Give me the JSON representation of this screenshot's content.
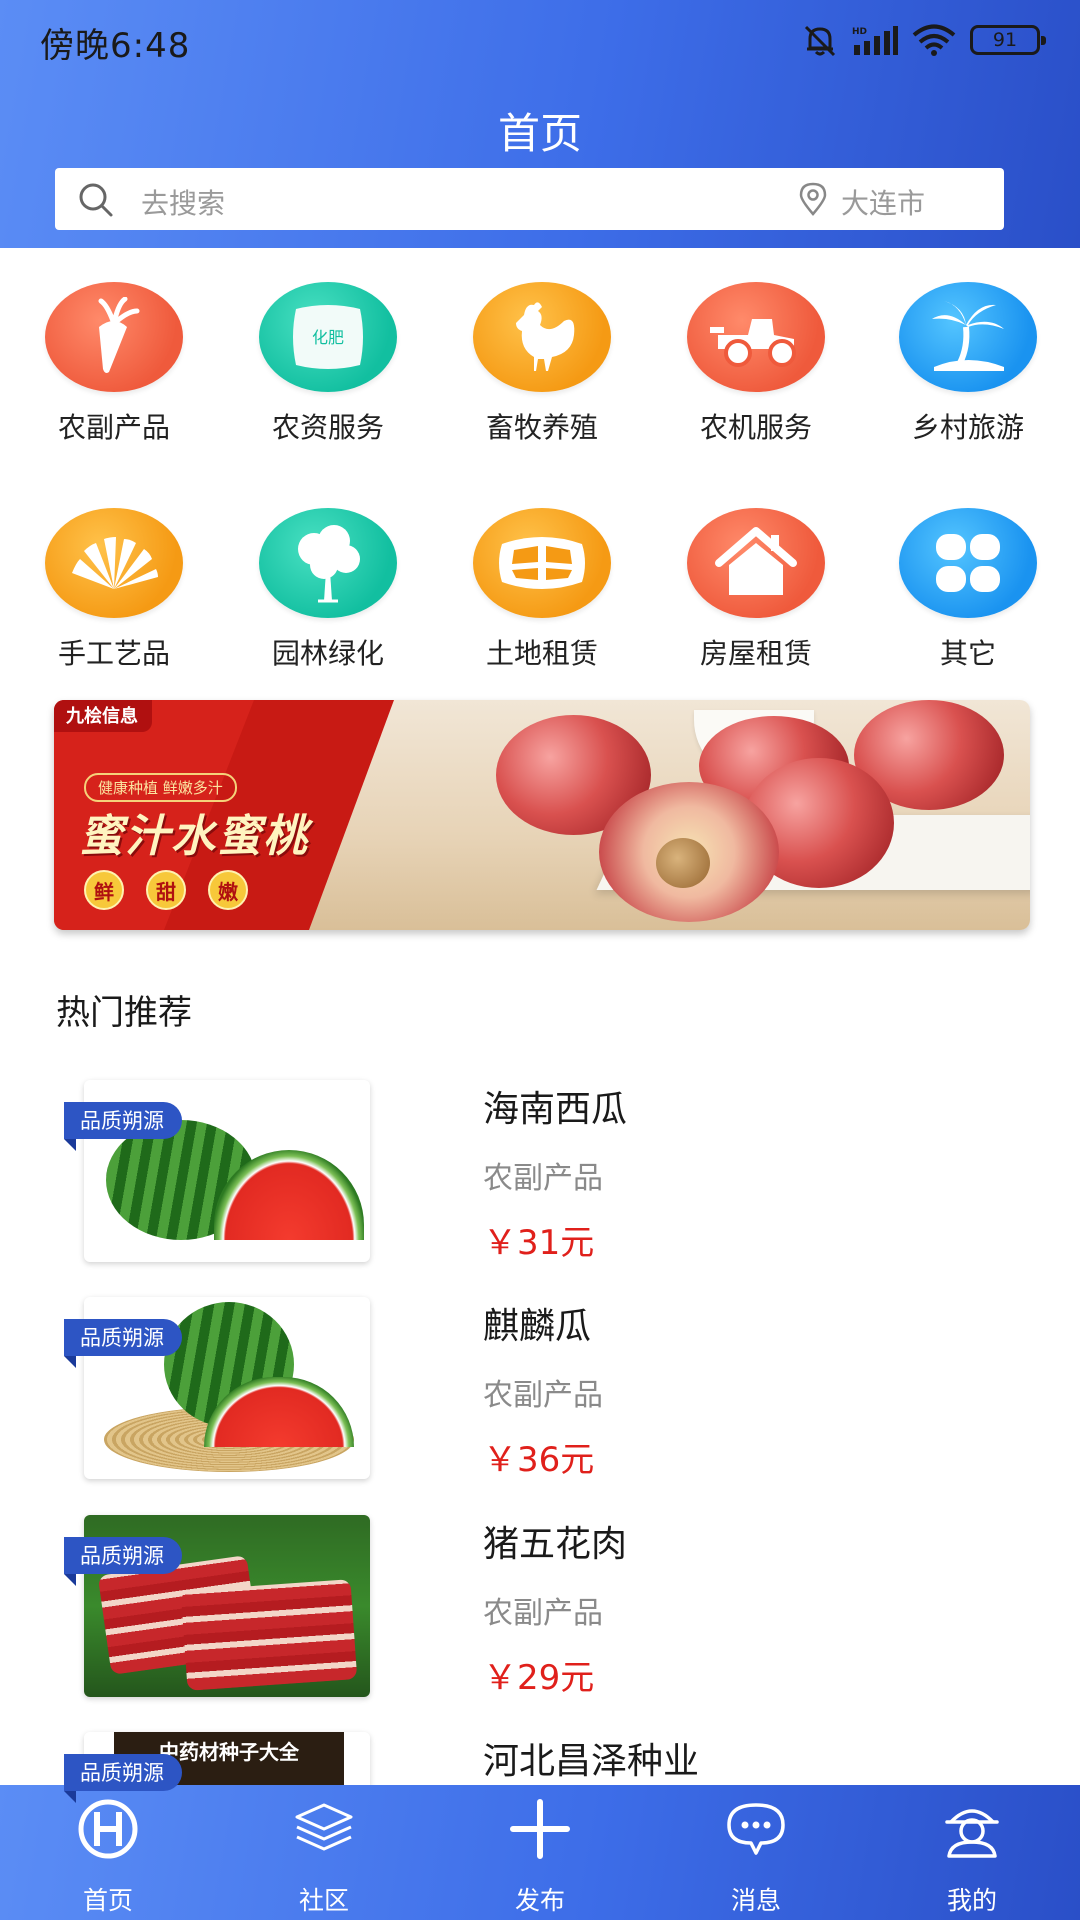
{
  "status_bar": {
    "time": "傍晚6:48",
    "battery": "91"
  },
  "header": {
    "title": "首页"
  },
  "search": {
    "placeholder": "去搜索",
    "location": "大连市"
  },
  "categories": [
    {
      "label": "农副产品",
      "icon": "carrot-icon",
      "color": "#ef5a3c"
    },
    {
      "label": "农资服务",
      "icon": "fertilizer-bag-icon",
      "color": "#12bfa0",
      "icon_text": "化肥"
    },
    {
      "label": "畜牧养殖",
      "icon": "rooster-icon",
      "color": "#f59a14"
    },
    {
      "label": "农机服务",
      "icon": "tractor-icon",
      "color": "#ef5a3c"
    },
    {
      "label": "乡村旅游",
      "icon": "palm-island-icon",
      "color": "#1a93f0"
    },
    {
      "label": "手工艺品",
      "icon": "fan-icon",
      "color": "#f59a14"
    },
    {
      "label": "园林绿化",
      "icon": "tree-icon",
      "color": "#12bfa0"
    },
    {
      "label": "土地租赁",
      "icon": "land-plots-icon",
      "color": "#f59a14"
    },
    {
      "label": "房屋租赁",
      "icon": "house-icon",
      "color": "#ef5a3c"
    },
    {
      "label": "其它",
      "icon": "four-petal-icon",
      "color": "#1a93f0"
    }
  ],
  "banner": {
    "brand": "九桧信息",
    "tagline": "健康种植 鲜嫩多汁",
    "headline": "蜜汁水蜜桃",
    "badges": [
      "鲜",
      "甜",
      "嫩"
    ]
  },
  "section": {
    "title": "热门推荐"
  },
  "products": [
    {
      "name": "海南西瓜",
      "category": "农副产品",
      "price": "￥31元",
      "badge": "品质朔源",
      "thumb": "watermelon"
    },
    {
      "name": "麒麟瓜",
      "category": "农副产品",
      "price": "￥36元",
      "badge": "品质朔源",
      "thumb": "watermelon-mat"
    },
    {
      "name": "猪五花肉",
      "category": "农副产品",
      "price": "￥29元",
      "badge": "品质朔源",
      "thumb": "pork-belly"
    },
    {
      "name": "河北昌泽种业",
      "category": "",
      "price": "",
      "badge": "品质朔源",
      "thumb": "seeds",
      "thumb_title": "中药材种子大全"
    }
  ],
  "bottom_nav": [
    {
      "label": "首页",
      "icon": "home-logo-icon"
    },
    {
      "label": "社区",
      "icon": "layers-icon"
    },
    {
      "label": "发布",
      "icon": "plus-icon"
    },
    {
      "label": "消息",
      "icon": "chat-bubble-icon"
    },
    {
      "label": "我的",
      "icon": "user-icon"
    }
  ],
  "colors": {
    "header_start": "#5b8df5",
    "header_end": "#2a4fc8",
    "price": "#e0201b",
    "badge": "#2d55c4"
  }
}
